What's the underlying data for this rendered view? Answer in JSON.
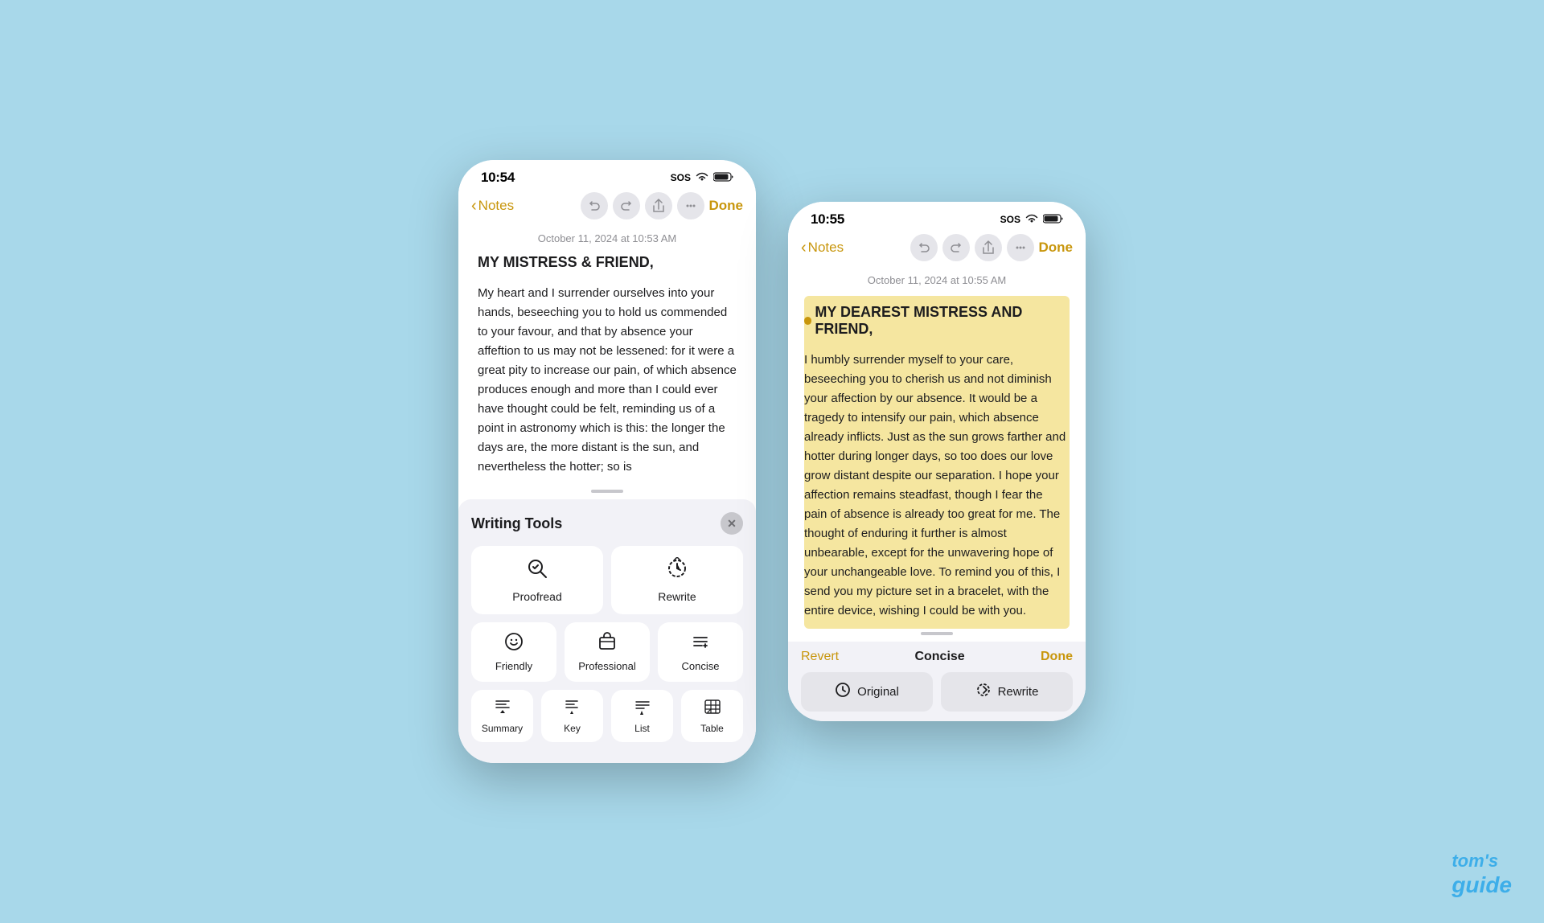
{
  "background_color": "#a8d8ea",
  "watermark": {
    "line1": "tom's",
    "line2": "guide"
  },
  "left_phone": {
    "status_bar": {
      "time": "10:54",
      "sos": "SOS",
      "wifi": "wifi",
      "battery": "battery"
    },
    "nav": {
      "back_label": "Notes",
      "done_label": "Done"
    },
    "note": {
      "date": "October 11, 2024 at 10:53 AM",
      "title": "MY MISTRESS & FRIEND,",
      "body": "My heart and I surrender ourselves into your hands, beseeching you to hold us commended to your favour, and that by absence your affeftion to us may not be lessened: for it were a great pity to increase our pain, of which absence produces enough and more than I could ever have thought could be felt, reminding us of a point in astronomy which is this: the longer the days are, the more distant is the sun, and nevertheless the hotter; so is"
    },
    "writing_tools": {
      "title": "Writing Tools",
      "close_label": "×",
      "tools": [
        {
          "id": "proofread",
          "label": "Proofread",
          "icon": "search-check"
        },
        {
          "id": "rewrite",
          "label": "Rewrite",
          "icon": "refresh-circle"
        },
        {
          "id": "friendly",
          "label": "Friendly",
          "icon": "smiley"
        },
        {
          "id": "professional",
          "label": "Professional",
          "icon": "briefcase"
        },
        {
          "id": "concise",
          "label": "Concise",
          "icon": "adjust"
        },
        {
          "id": "summary",
          "label": "Summary",
          "icon": "lines-down"
        },
        {
          "id": "key",
          "label": "Key",
          "icon": "lines-down-2"
        },
        {
          "id": "list",
          "label": "List",
          "icon": "lines-small"
        },
        {
          "id": "table",
          "label": "Table",
          "icon": "grid"
        }
      ]
    }
  },
  "right_phone": {
    "status_bar": {
      "time": "10:55",
      "sos": "SOS",
      "wifi": "wifi",
      "battery": "battery"
    },
    "nav": {
      "back_label": "Notes",
      "done_label": "Done"
    },
    "note": {
      "date": "October 11, 2024 at 10:55 AM",
      "title": "MY DEAREST MISTRESS AND FRIEND,",
      "body": "I humbly surrender myself to your care, beseeching you to cherish us and not diminish your affection by our absence. It would be a tragedy to intensify our pain, which absence already inflicts. Just as the sun grows farther and hotter during longer days, so too does our love grow distant despite our separation. I hope your affection remains steadfast, though I fear the pain of absence is already too great for me. The thought of enduring it further is almost unbearable, except for the unwavering hope of your unchangeable love. To remind you of this, I send you my picture set in a bracelet, with the entire device, wishing I could be with you."
    },
    "rewrite_bar": {
      "revert_label": "Revert",
      "concise_label": "Concise",
      "done_label": "Done",
      "original_label": "Original",
      "rewrite_label": "Rewrite"
    }
  }
}
